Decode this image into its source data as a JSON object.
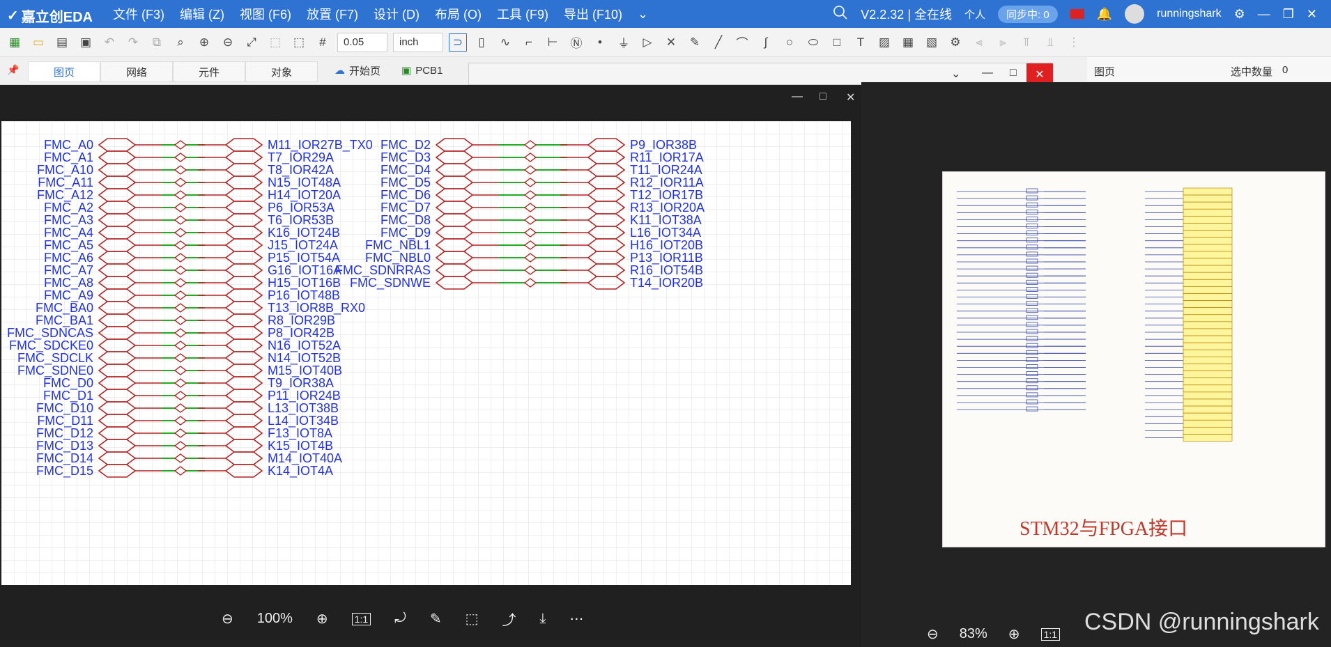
{
  "app": {
    "logo_text": "嘉立创EDA",
    "version": "V2.2.32 | 全在线",
    "personal": "个人",
    "sync": "同步中: 0",
    "user": "runningshark"
  },
  "menu": [
    "文件 (F3)",
    "编辑 (Z)",
    "视图 (F6)",
    "放置 (F7)",
    "设计 (D)",
    "布局 (O)",
    "工具 (F9)",
    "导出 (F10)"
  ],
  "toolbar": {
    "grid": "0.05",
    "unit": "inch"
  },
  "left_tabs": [
    "图页",
    "网络",
    "元件",
    "对象"
  ],
  "doc_tabs": {
    "home": "开始页",
    "pcb": "PCB1"
  },
  "right_panel": {
    "title": "图页",
    "selected": "选中数量",
    "count": "0"
  },
  "viewer1": {
    "zoom": "100%",
    "ratio": "1:1"
  },
  "viewer2": {
    "zoom": "83%",
    "ratio": "1:1",
    "title": "STM32与FPGA接口"
  },
  "watermark": "CSDN @runningshark",
  "colors": {
    "titlebar": "#2e72d2",
    "net_label": "#2233dd",
    "wire_red": "#b22222",
    "wire_green": "#22aa22"
  },
  "schematic": {
    "left_nets": [
      {
        "net": "FMC_A0",
        "pin": "M11_IOR27B_TX0"
      },
      {
        "net": "FMC_A1",
        "pin": "T7_IOR29A"
      },
      {
        "net": "FMC_A10",
        "pin": "T8_IOR42A"
      },
      {
        "net": "FMC_A11",
        "pin": "N15_IOT48A"
      },
      {
        "net": "FMC_A12",
        "pin": "H14_IOT20A"
      },
      {
        "net": "FMC_A2",
        "pin": "P6_IOR53A"
      },
      {
        "net": "FMC_A3",
        "pin": "T6_IOR53B"
      },
      {
        "net": "FMC_A4",
        "pin": "K16_IOT24B"
      },
      {
        "net": "FMC_A5",
        "pin": "J15_IOT24A"
      },
      {
        "net": "FMC_A6",
        "pin": "P15_IOT54A"
      },
      {
        "net": "FMC_A7",
        "pin": "G16_IOT16A"
      },
      {
        "net": "FMC_A8",
        "pin": "H15_IOT16B"
      },
      {
        "net": "FMC_A9",
        "pin": "P16_IOT48B"
      },
      {
        "net": "FMC_BA0",
        "pin": "T13_IOR8B_RX0"
      },
      {
        "net": "FMC_BA1",
        "pin": "R8_IOR29B"
      },
      {
        "net": "FMC_SDNCAS",
        "pin": "P8_IOR42B"
      },
      {
        "net": "FMC_SDCKE0",
        "pin": "N16_IOT52A"
      },
      {
        "net": "FMC_SDCLK",
        "pin": "N14_IOT52B"
      },
      {
        "net": "FMC_SDNE0",
        "pin": "M15_IOT40B"
      },
      {
        "net": "FMC_D0",
        "pin": "T9_IOR38A"
      },
      {
        "net": "FMC_D1",
        "pin": "P11_IOR24B"
      },
      {
        "net": "FMC_D10",
        "pin": "L13_IOT38B"
      },
      {
        "net": "FMC_D11",
        "pin": "L14_IOT34B"
      },
      {
        "net": "FMC_D12",
        "pin": "F13_IOT8A"
      },
      {
        "net": "FMC_D13",
        "pin": "K15_IOT4B"
      },
      {
        "net": "FMC_D14",
        "pin": "M14_IOT40A"
      },
      {
        "net": "FMC_D15",
        "pin": "K14_IOT4A"
      }
    ],
    "right_nets": [
      {
        "net": "FMC_D2",
        "pin": "P9_IOR38B"
      },
      {
        "net": "FMC_D3",
        "pin": "R11_IOR17A"
      },
      {
        "net": "FMC_D4",
        "pin": "T11_IOR24A"
      },
      {
        "net": "FMC_D5",
        "pin": "R12_IOR11A"
      },
      {
        "net": "FMC_D6",
        "pin": "T12_IOR17B"
      },
      {
        "net": "FMC_D7",
        "pin": "R13_IOR20A"
      },
      {
        "net": "FMC_D8",
        "pin": "K11_IOT38A"
      },
      {
        "net": "FMC_D9",
        "pin": "L16_IOT34A"
      },
      {
        "net": "FMC_NBL1",
        "pin": "H16_IOT20B"
      },
      {
        "net": "FMC_NBL0",
        "pin": "P13_IOR11B"
      },
      {
        "net": "FMC_SDNRRAS",
        "pin": "R16_IOT54B"
      },
      {
        "net": "FMC_SDNWE",
        "pin": "T14_IOR20B"
      }
    ]
  }
}
